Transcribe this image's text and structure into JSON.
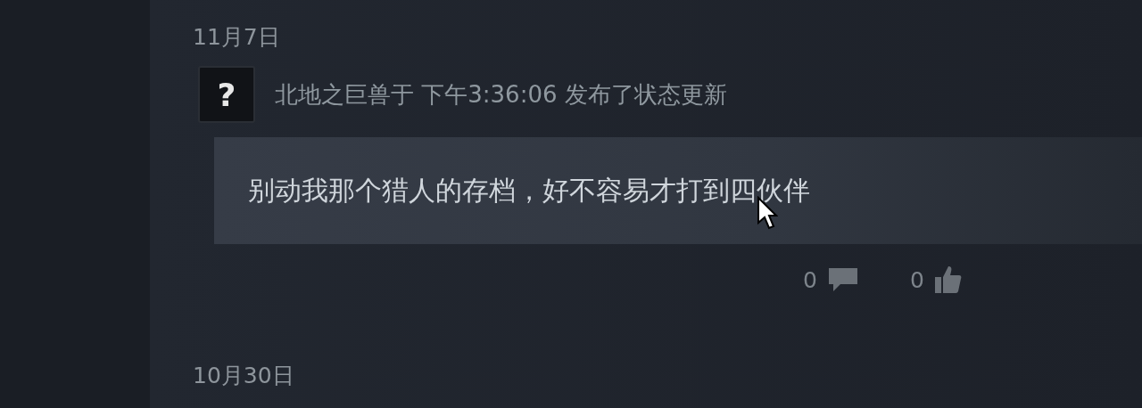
{
  "days": [
    {
      "date": "11月7日",
      "posts": [
        {
          "author_line": "北地之巨兽于 下午3:36:06 发布了状态更新",
          "avatar_text": "?",
          "body": "别动我那个猎人的存档，好不容易才打到四伙伴",
          "comments": "0",
          "likes": "0"
        }
      ]
    },
    {
      "date": "10月30日"
    }
  ]
}
